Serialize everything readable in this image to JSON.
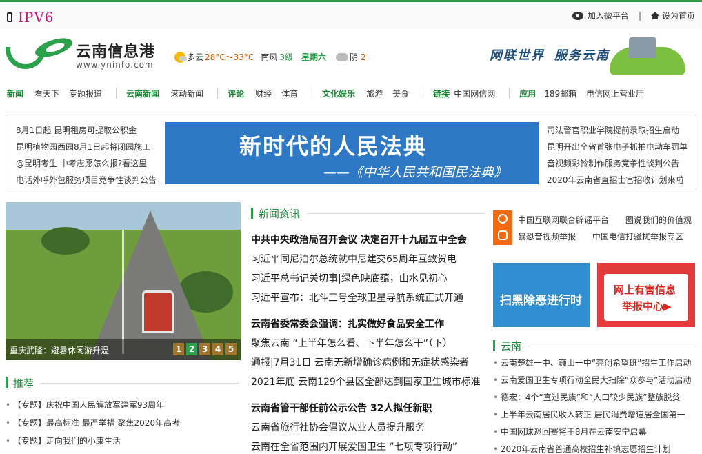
{
  "topbar": {
    "ipv6": "IPV6",
    "weibo": "加入微平台",
    "separator": "|",
    "homepage": "设为首页"
  },
  "logo": {
    "cn": "云南信息港",
    "en": "www.yninfo.com"
  },
  "weather": {
    "cond": "多云",
    "temp": "28°C～33°C",
    "wind": "南风",
    "wind_level": "3级",
    "weekday": "星期六",
    "cond2": "阴",
    "temp2": "2"
  },
  "slogan": {
    "s1": "网联世界",
    "s2": "服务云南"
  },
  "nav": [
    {
      "group": "新闻",
      "items": [
        "看天下",
        "专题报道"
      ]
    },
    {
      "group": "云南新闻",
      "items": [
        "滚动新闻"
      ]
    },
    {
      "group": "评论",
      "items": [
        "财经",
        "体育"
      ]
    },
    {
      "group": "文化娱乐",
      "items": [
        "旅游",
        "美食"
      ]
    },
    {
      "group": "链接",
      "items": [
        "中国网信网"
      ]
    },
    {
      "group": "应用",
      "items": [
        "189邮箱",
        "电信网上营业厅"
      ]
    }
  ],
  "notice_left": [
    "8月1日起 昆明租房可提取公积金",
    "昆明植物园西园8月1日起将闭园施工",
    "@昆明考生 中考志愿怎么报?看这里",
    "电话外呼外包服务项目竞争性谈判公告"
  ],
  "civil_banner": {
    "title": "新时代的人民法典",
    "subtitle": "——《中华人民共和国民法典》"
  },
  "notice_right": [
    "司法警官职业学院提前录取招生启动",
    "昆明开出全省首张电子抓拍电动车罚单",
    "音视频彩铃制作服务竞争性谈判公告",
    "2020年云南省直招士官招收计划来啦"
  ],
  "slide": {
    "caption": "重庆武隆：避暑休闲游升温",
    "pages": [
      "1",
      "2",
      "3",
      "4",
      "5"
    ],
    "active_page": 2
  },
  "sections": {
    "recommend": "推荐",
    "news": "新闻资讯",
    "yunnan": "云南"
  },
  "recommend": [
    "【专题】庆祝中国人民解放军建军93周年",
    "【专题】最高标准 最严举措 聚焦2020年高考",
    "【专题】走向我们的小康生活"
  ],
  "news": {
    "groups": [
      {
        "headline": "中共中央政治局召开会议 决定召开十九届五中全会",
        "items": [
          "习近平同尼泊尔总统就中尼建交65周年互致贺电",
          "习近平总书记关切事|绿色映底蕴，山水见初心",
          "习近平宣布：北斗三号全球卫星导航系统正式开通"
        ]
      },
      {
        "headline": "云南省委常委会强调：扎实做好食品安全工作",
        "items": [
          "聚焦云南 “上半年怎么看、下半年怎么干”（下）",
          "通报|7月31日 云南无新增确诊病例和无症状感染者",
          "2021年底 云南129个县区全部达到国家卫生城市标准"
        ]
      },
      {
        "headline": "云南省管干部任前公示公告 32人拟任新职",
        "items": [
          "云南省旅行社协会倡议从业人员提升服务",
          "云南在全省范围内开展爱国卫生 “七项专项行动”"
        ]
      }
    ]
  },
  "report": {
    "row1": [
      "中国互联网联合辟谣平台",
      "图说我们的价值观"
    ],
    "row2": [
      "暴恐音视频举报",
      "中国电信打骚扰举报专区"
    ]
  },
  "badges": {
    "blue": "扫黑除恶进行时",
    "red1": "网上有害信息",
    "red2": "举报中心▶"
  },
  "yunnan_list": [
    "云南楚雄一中、巍山一中“亮创希望班”招生工作启动",
    "云南爱国卫生专项行动全民大扫除“众参与”活动启动",
    "德宏：4个“直过民族”和“人口较少民族”整族脱贫",
    "上半年云南居民收入转正 居民消费增速居全国第一",
    "中国网球巡回赛将于8月在云南安宁启幕",
    "2020年云南省普通高校招生补填志愿招生计划"
  ],
  "colors": {
    "brand_green": "#2aa14a",
    "ipv6": "#c8137d",
    "banner_blue": "#2f78c6",
    "alert_red": "#e23b3b",
    "report_orange": "#f26a12"
  },
  "icons": [
    "phone-icon",
    "weibo-icon",
    "home-icon",
    "sun-icon",
    "cloud-icon",
    "rumor-icon",
    "report-icon"
  ]
}
